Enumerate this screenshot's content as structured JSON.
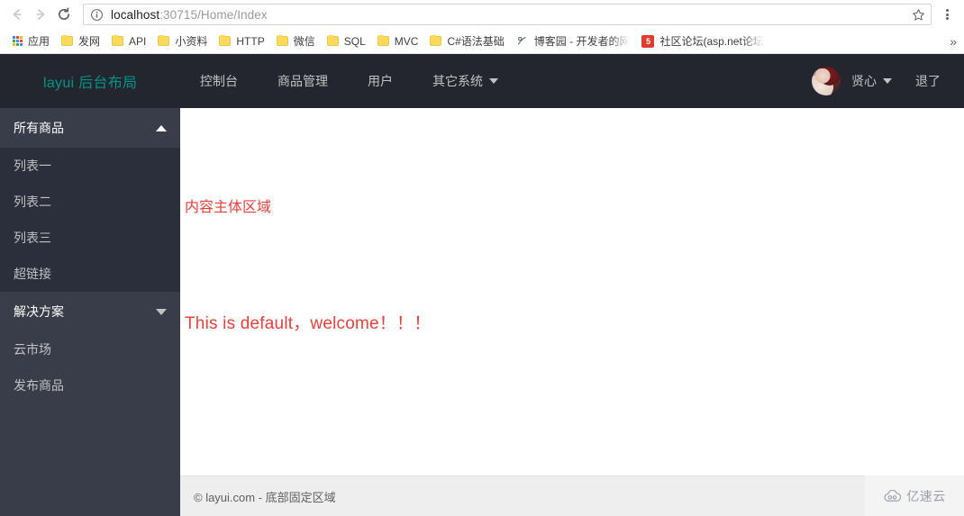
{
  "browser": {
    "back_icon": "arrow-left-icon",
    "forward_icon": "arrow-right-icon",
    "reload_icon": "reload-icon",
    "info_icon": "page-info-icon",
    "url_host": "localhost",
    "url_rest": ":30715/Home/Index",
    "star_icon": "bookmark-star-icon",
    "menu_icon": "three-dot-menu-icon",
    "bookmarks": [
      {
        "label": "应用",
        "icon": "apps-grid-icon"
      },
      {
        "label": "发网",
        "icon": "folder-icon"
      },
      {
        "label": "API",
        "icon": "folder-icon"
      },
      {
        "label": "小资料",
        "icon": "folder-icon"
      },
      {
        "label": "HTTP",
        "icon": "folder-icon"
      },
      {
        "label": "微信",
        "icon": "folder-icon"
      },
      {
        "label": "SQL",
        "icon": "folder-icon"
      },
      {
        "label": "MVC",
        "icon": "folder-icon"
      },
      {
        "label": "C#语法基础",
        "icon": "folder-icon"
      },
      {
        "label": "博客园 - 开发者的网",
        "icon": "cnblogs-favicon"
      },
      {
        "label": "社区论坛(asp.net论坛",
        "icon": "forum-favicon"
      }
    ],
    "overflow_label": "»"
  },
  "header": {
    "logo": "layui 后台布局",
    "logo_color": "#009688",
    "nav": [
      {
        "label": "控制台",
        "has_caret": false
      },
      {
        "label": "商品管理",
        "has_caret": false
      },
      {
        "label": "用户",
        "has_caret": false
      },
      {
        "label": "其它系统",
        "has_caret": true
      }
    ],
    "avatar_icon": "user-avatar",
    "user_name": "贤心",
    "logout_label": "退了",
    "background": "#23262E"
  },
  "sidebar": {
    "background": "#393D49",
    "sub_background": "#2B2E3B",
    "groups": [
      {
        "title": "所有商品",
        "expanded": true,
        "arrow_icon": "chevron-up-icon",
        "items": [
          "列表一",
          "列表二",
          "列表三",
          "超链接"
        ]
      },
      {
        "title": "解决方案",
        "expanded": false,
        "arrow_icon": "chevron-down-icon",
        "items": []
      }
    ],
    "flat_items": [
      "云市场",
      "发布商品"
    ]
  },
  "content": {
    "line1": "内容主体区域",
    "line2": "This is default，welcome！！！",
    "text_color": "#e8403a"
  },
  "footer": {
    "text": "© layui.com - 底部固定区域",
    "background": "#eeeeee"
  },
  "watermark": {
    "icon": "cloud-icon",
    "text": "亿速云"
  }
}
